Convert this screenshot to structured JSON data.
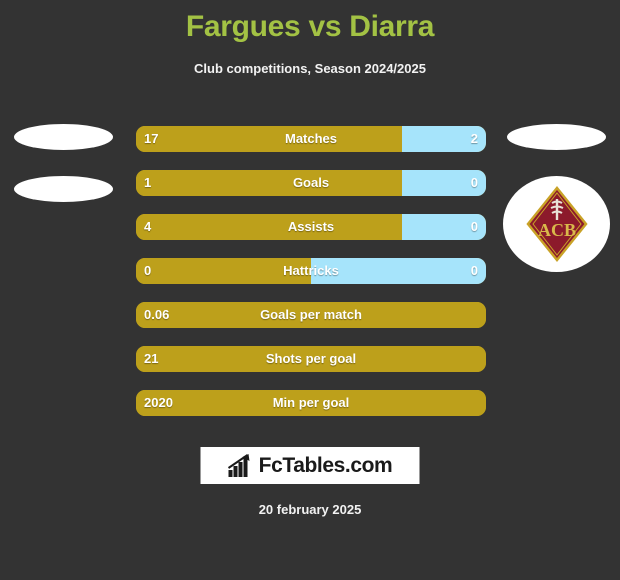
{
  "header": {
    "title": "Fargues vs Diarra",
    "subtitle": "Club competitions, Season 2024/2025",
    "title_color": "#a3c244"
  },
  "colors": {
    "background": "#333333",
    "home_bar": "#bda01b",
    "away_bar": "#a6e4fb",
    "title": "#a3c244",
    "text": "#ffffff",
    "badge_red": "#8c1a2b",
    "badge_gold": "#c9a227"
  },
  "players": {
    "home": {
      "name": "Fargues",
      "photo_placeholder_1": "player-photo-placeholder",
      "photo_placeholder_2": "player-photo-placeholder"
    },
    "away": {
      "name": "Diarra",
      "photo_placeholder_1": "player-photo-placeholder",
      "club_badge": "acb-club-badge",
      "club_badge_text": "ACB"
    }
  },
  "stats": [
    {
      "label": "Matches",
      "home": "17",
      "away": "2",
      "home_pct": 76,
      "away_pct": 24,
      "split": true
    },
    {
      "label": "Goals",
      "home": "1",
      "away": "0",
      "home_pct": 76,
      "away_pct": 24,
      "split": true
    },
    {
      "label": "Assists",
      "home": "4",
      "away": "0",
      "home_pct": 76,
      "away_pct": 24,
      "split": true
    },
    {
      "label": "Hattricks",
      "home": "0",
      "away": "0",
      "home_pct": 50,
      "away_pct": 50,
      "split": true
    },
    {
      "label": "Goals per match",
      "home": "0.06",
      "away": "",
      "home_pct": 100,
      "away_pct": 0,
      "split": false
    },
    {
      "label": "Shots per goal",
      "home": "21",
      "away": "",
      "home_pct": 100,
      "away_pct": 0,
      "split": false
    },
    {
      "label": "Min per goal",
      "home": "2020",
      "away": "",
      "home_pct": 100,
      "away_pct": 0,
      "split": false
    }
  ],
  "footer": {
    "brand": "FcTables.com",
    "brand_icon": "bar-chart-arrow-icon",
    "date": "20 february 2025"
  }
}
